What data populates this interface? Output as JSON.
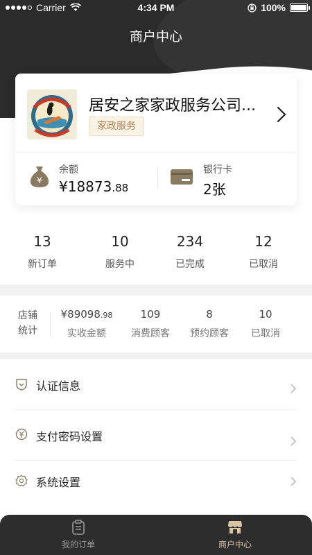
{
  "status_bar": {
    "carrier": "Carrier",
    "time": "4:34 PM",
    "battery": "100%"
  },
  "nav": {
    "title": "商户中心"
  },
  "merchant": {
    "logo_name": "stay-glassy-san-diego-logo",
    "name": "居安之家家政服务公司...",
    "tag": "家政服务",
    "balance_label": "余额",
    "balance_currency": "¥",
    "balance_int": "18873",
    "balance_dec": ".88",
    "bank_label": "银行卡",
    "bank_value": "2张"
  },
  "order_counts": [
    {
      "value": "13",
      "label": "新订单"
    },
    {
      "value": "10",
      "label": "服务中"
    },
    {
      "value": "234",
      "label": "已完成"
    },
    {
      "value": "12",
      "label": "已取消"
    }
  ],
  "shop_stats": {
    "label_line1": "店铺",
    "label_line2": "统计",
    "revenue_int": "¥89098",
    "revenue_dec": ".98",
    "revenue_label": "实收金额",
    "customers": "109",
    "customers_label": "消费顾客",
    "appointments": "8",
    "appointments_label": "预约顾客",
    "cancelled": "10",
    "cancelled_label": "已取消"
  },
  "menu": [
    {
      "label": "认证信息",
      "icon": "shield-check-icon"
    },
    {
      "label": "支付密码设置",
      "icon": "yuan-circle-icon"
    },
    {
      "label": "系统设置",
      "icon": "gear-icon"
    }
  ],
  "tabbar": {
    "tabs": [
      {
        "label": "我的订单",
        "icon": "clipboard-icon",
        "active": false
      },
      {
        "label": "商户中心",
        "icon": "shop-icon",
        "active": true
      }
    ]
  },
  "colors": {
    "header": "#2b2b2b",
    "accent": "#b08552",
    "active_tab": "#d9c4a3"
  }
}
